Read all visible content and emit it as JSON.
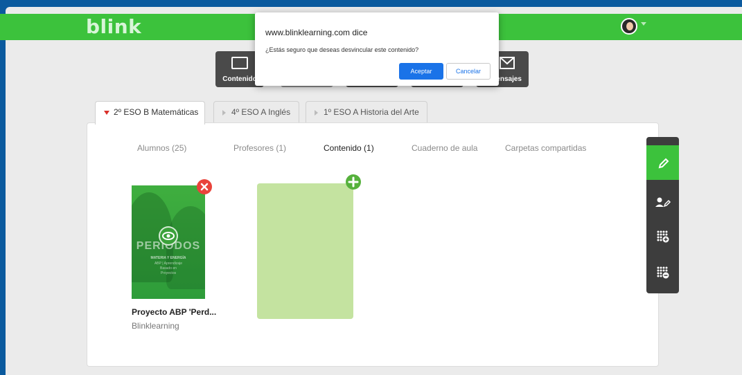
{
  "brand": {
    "logo": "blink"
  },
  "dialog": {
    "title": "www.blinklearning.com dice",
    "message": "¿Estás seguro que deseas desvincular este contenido?",
    "accept_label": "Aceptar",
    "cancel_label": "Cancelar"
  },
  "app_buttons": [
    {
      "label": "Contenido",
      "icon": "book-icon"
    },
    {
      "label": "",
      "icon": ""
    },
    {
      "label": "",
      "icon": ""
    },
    {
      "label": "",
      "icon": ""
    },
    {
      "label": "ensajes",
      "icon": "mail-icon"
    }
  ],
  "class_tabs": [
    {
      "label": "2º ESO B Matemáticas",
      "active": true
    },
    {
      "label": "4º ESO A Inglés",
      "active": false
    },
    {
      "label": "1º ESO A Historia del Arte",
      "active": false
    }
  ],
  "sub_tabs": [
    {
      "label": "Alumnos (25)"
    },
    {
      "label": "Profesores (1)"
    },
    {
      "label": "Contenido (1)",
      "active": true
    },
    {
      "label": "Cuaderno de aula"
    },
    {
      "label": "Carpetas compartidas"
    }
  ],
  "content": {
    "book": {
      "cover_title": "PERIODOS",
      "cover_subtitle": "MATERIA Y ENERGÍA",
      "cover_sub2_a": "ABP | Aprendizaje",
      "cover_sub2_b": "Basado en",
      "cover_sub2_c": "Proyectos",
      "title": "Proyecto ABP 'Perd...",
      "publisher": "Blinklearning"
    }
  },
  "right_toolbar": [
    {
      "icon": "pencil-icon",
      "active": true
    },
    {
      "icon": "user-edit-icon"
    },
    {
      "icon": "grid-add-icon"
    },
    {
      "icon": "grid-remove-icon"
    }
  ],
  "colors": {
    "brand_green": "#3cc23c",
    "accept_blue": "#1a73e8",
    "remove_red": "#e9433b"
  }
}
